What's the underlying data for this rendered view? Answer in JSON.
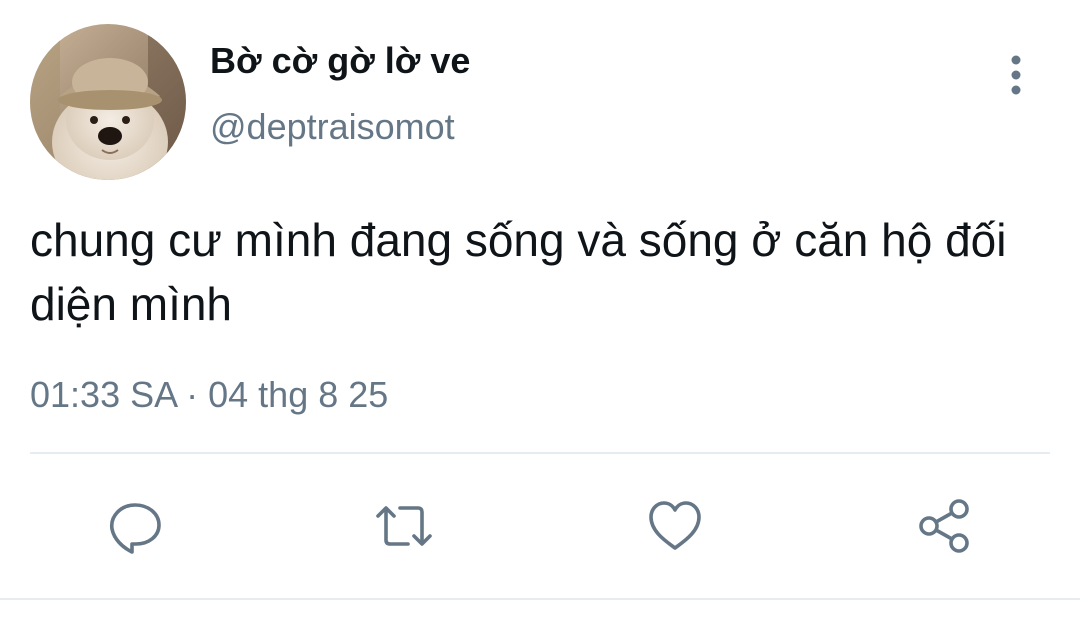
{
  "tweet": {
    "display_name": "Bờ cờ gờ lờ ve",
    "handle": "@deptraisomot",
    "text": "chung cư mình đang sống và sống ở căn hộ đối diện mình",
    "timestamp": "01:33 SA · 04 thg 8 25"
  },
  "icons": {
    "avatar": "avatar-dog-with-hat",
    "more": "more-vertical-icon",
    "reply": "reply-icon",
    "retweet": "retweet-icon",
    "like": "heart-icon",
    "share": "share-icon"
  },
  "colors": {
    "text": "#0f1419",
    "secondary": "#657786",
    "divider": "#e6ecf0",
    "icon": "#657786"
  }
}
